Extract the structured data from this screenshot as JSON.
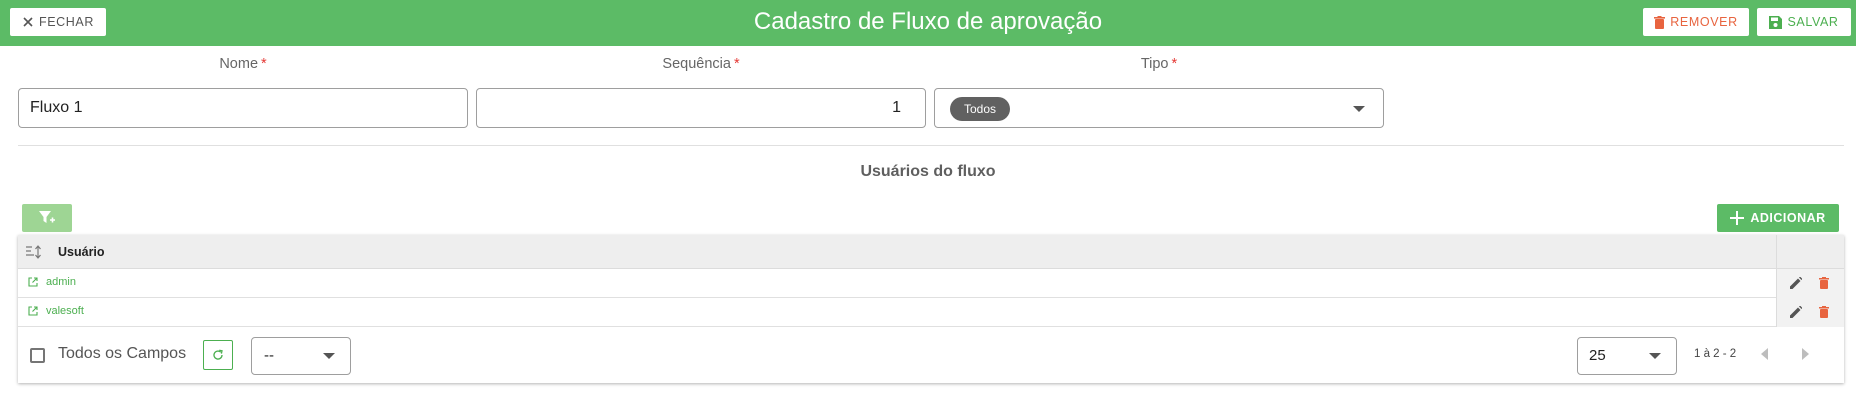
{
  "header": {
    "title": "Cadastro de Fluxo de aprovação",
    "close_label": "FECHAR",
    "remove_label": "REMOVER",
    "save_label": "SALVAR"
  },
  "form": {
    "nome": {
      "label": "Nome",
      "required": "*",
      "value": "Fluxo 1"
    },
    "sequencia": {
      "label": "Sequência",
      "required": "*",
      "value": "1"
    },
    "tipo": {
      "label": "Tipo",
      "required": "*",
      "chip": "Todos"
    }
  },
  "users_section": {
    "title": "Usuários do fluxo",
    "add_label": "ADICIONAR",
    "column_header": "Usuário",
    "rows": [
      {
        "usuario": "admin"
      },
      {
        "usuario": "valesoft"
      }
    ]
  },
  "grid_footer": {
    "checkbox_label": "Todos os Campos",
    "fields_select_value": "--",
    "page_size": "25",
    "page_info": "1 à 2 - 2"
  },
  "colors": {
    "primary": "#5cbb66",
    "danger": "#e8643f",
    "link": "#4caf50"
  }
}
